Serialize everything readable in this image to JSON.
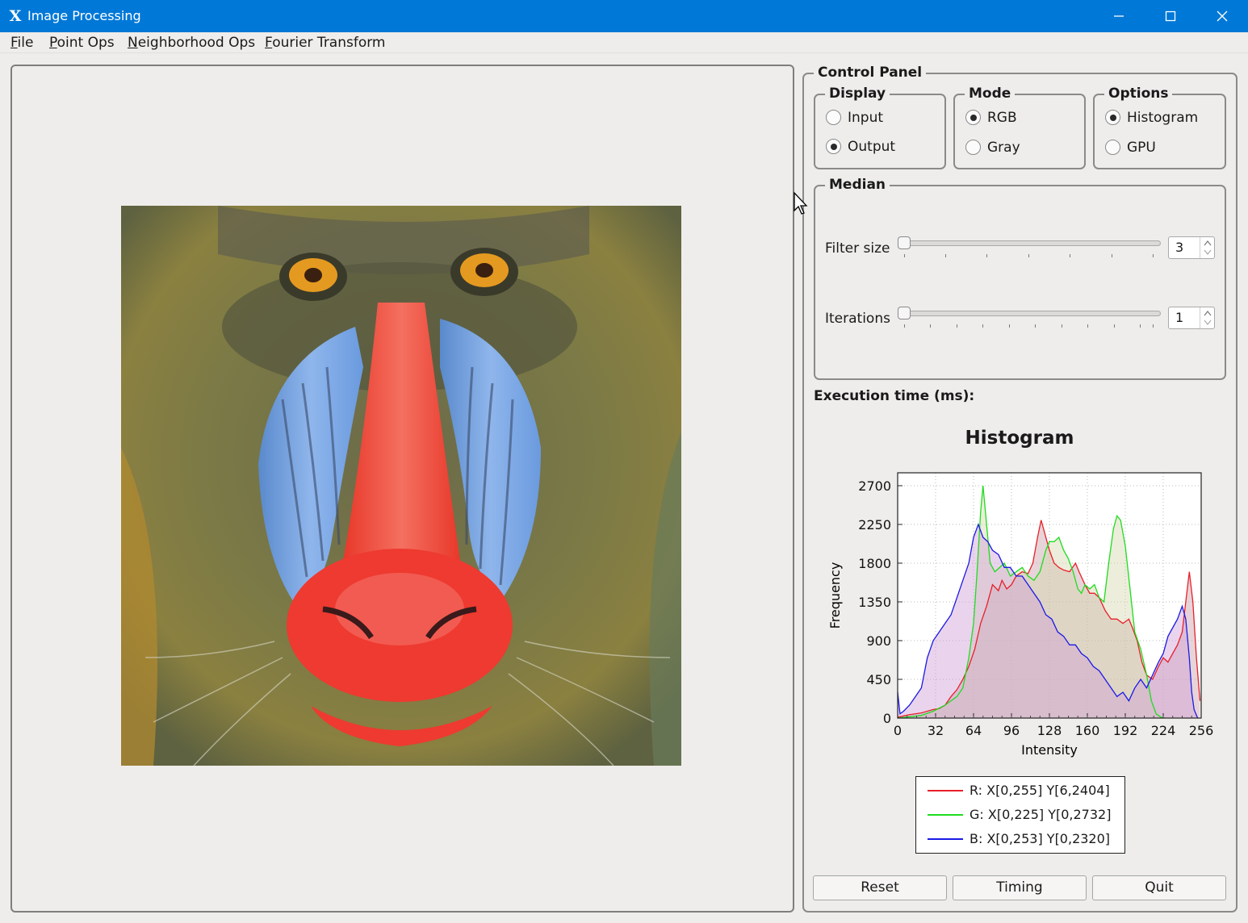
{
  "window": {
    "title": "Image Processing",
    "app_icon": "x-app-icon",
    "controls": [
      "minimize-icon",
      "maximize-icon",
      "close-icon"
    ]
  },
  "menubar": {
    "items": [
      {
        "label_mn": "F",
        "label_rest": "ile"
      },
      {
        "label_mn": "P",
        "label_rest": "oint Ops"
      },
      {
        "label_mn": "N",
        "label_rest": "eighborhood Ops"
      },
      {
        "label_mn": "F",
        "label_rest": "ourier Transform"
      }
    ]
  },
  "control_panel": {
    "title": "Control Panel",
    "display": {
      "title": "Display",
      "options": [
        "Input",
        "Output"
      ],
      "selected": "Output"
    },
    "mode": {
      "title": "Mode",
      "options": [
        "RGB",
        "Gray"
      ],
      "selected": "RGB"
    },
    "options": {
      "title": "Options",
      "options": [
        "Histogram",
        "GPU"
      ],
      "selected": "Histogram"
    },
    "median": {
      "title": "Median",
      "filter_size_label": "Filter size",
      "filter_size_value": "3",
      "iterations_label": "Iterations",
      "iterations_value": "1"
    },
    "execution_time_label": "Execution time (ms):"
  },
  "buttons": {
    "reset": "Reset",
    "timing": "Timing",
    "quit": "Quit"
  },
  "chart_data": {
    "type": "line",
    "title": "Histogram",
    "xlabel": "Intensity",
    "ylabel": "Frequency",
    "xlim": [
      0,
      256
    ],
    "ylim": [
      0,
      2850
    ],
    "xticks": [
      0,
      32,
      64,
      96,
      128,
      160,
      192,
      224,
      256
    ],
    "yticks": [
      0,
      450,
      900,
      1350,
      1800,
      2250,
      2700
    ],
    "grid": true,
    "legend_position": "below",
    "series": [
      {
        "name": "R: X[0,255] Y[6,2404]",
        "color": "#e8202a",
        "fill": "#c8a0a8",
        "points": [
          [
            0,
            10
          ],
          [
            10,
            40
          ],
          [
            20,
            60
          ],
          [
            30,
            100
          ],
          [
            35,
            110
          ],
          [
            40,
            150
          ],
          [
            45,
            250
          ],
          [
            50,
            330
          ],
          [
            55,
            450
          ],
          [
            60,
            600
          ],
          [
            65,
            800
          ],
          [
            70,
            1100
          ],
          [
            75,
            1300
          ],
          [
            80,
            1550
          ],
          [
            85,
            1480
          ],
          [
            88,
            1600
          ],
          [
            92,
            1500
          ],
          [
            96,
            1550
          ],
          [
            100,
            1650
          ],
          [
            105,
            1700
          ],
          [
            110,
            1680
          ],
          [
            114,
            1800
          ],
          [
            118,
            2100
          ],
          [
            121,
            2300
          ],
          [
            124,
            2150
          ],
          [
            128,
            1950
          ],
          [
            132,
            1800
          ],
          [
            136,
            1750
          ],
          [
            140,
            1720
          ],
          [
            145,
            1700
          ],
          [
            150,
            1800
          ],
          [
            153,
            1700
          ],
          [
            158,
            1550
          ],
          [
            162,
            1450
          ],
          [
            166,
            1450
          ],
          [
            170,
            1400
          ],
          [
            175,
            1250
          ],
          [
            180,
            1150
          ],
          [
            185,
            1150
          ],
          [
            190,
            1100
          ],
          [
            195,
            1150
          ],
          [
            198,
            1050
          ],
          [
            202,
            900
          ],
          [
            206,
            650
          ],
          [
            210,
            500
          ],
          [
            215,
            450
          ],
          [
            220,
            600
          ],
          [
            224,
            700
          ],
          [
            228,
            650
          ],
          [
            232,
            750
          ],
          [
            236,
            850
          ],
          [
            240,
            1000
          ],
          [
            243,
            1350
          ],
          [
            246,
            1700
          ],
          [
            249,
            1350
          ],
          [
            252,
            700
          ],
          [
            255,
            200
          ]
        ]
      },
      {
        "name": "G: X[0,225] Y[0,2732]",
        "color": "#1edc1e",
        "fill": "#d8d8b0",
        "points": [
          [
            0,
            0
          ],
          [
            20,
            30
          ],
          [
            30,
            80
          ],
          [
            40,
            150
          ],
          [
            50,
            250
          ],
          [
            55,
            350
          ],
          [
            60,
            700
          ],
          [
            64,
            1100
          ],
          [
            67,
            1700
          ],
          [
            70,
            2400
          ],
          [
            72,
            2700
          ],
          [
            74,
            2400
          ],
          [
            78,
            1800
          ],
          [
            82,
            1700
          ],
          [
            86,
            1750
          ],
          [
            90,
            1800
          ],
          [
            95,
            1650
          ],
          [
            100,
            1700
          ],
          [
            105,
            1750
          ],
          [
            110,
            1650
          ],
          [
            115,
            1600
          ],
          [
            120,
            1700
          ],
          [
            125,
            1950
          ],
          [
            128,
            2050
          ],
          [
            132,
            2050
          ],
          [
            136,
            2100
          ],
          [
            140,
            1950
          ],
          [
            144,
            1850
          ],
          [
            148,
            1700
          ],
          [
            152,
            1500
          ],
          [
            155,
            1450
          ],
          [
            158,
            1550
          ],
          [
            162,
            1500
          ],
          [
            166,
            1550
          ],
          [
            170,
            1400
          ],
          [
            174,
            1350
          ],
          [
            178,
            1800
          ],
          [
            182,
            2200
          ],
          [
            185,
            2350
          ],
          [
            188,
            2300
          ],
          [
            192,
            2000
          ],
          [
            196,
            1500
          ],
          [
            200,
            1000
          ],
          [
            205,
            800
          ],
          [
            210,
            500
          ],
          [
            214,
            200
          ],
          [
            218,
            50
          ],
          [
            222,
            10
          ],
          [
            225,
            0
          ]
        ]
      },
      {
        "name": "B: X[0,253] Y[0,2320]",
        "color": "#1a1ae6",
        "fill": "#d0a0d8",
        "points": [
          [
            0,
            300
          ],
          [
            2,
            50
          ],
          [
            5,
            80
          ],
          [
            10,
            150
          ],
          [
            15,
            250
          ],
          [
            20,
            350
          ],
          [
            25,
            700
          ],
          [
            30,
            900
          ],
          [
            35,
            1000
          ],
          [
            40,
            1100
          ],
          [
            45,
            1200
          ],
          [
            50,
            1400
          ],
          [
            55,
            1600
          ],
          [
            60,
            1800
          ],
          [
            64,
            2100
          ],
          [
            68,
            2250
          ],
          [
            72,
            2100
          ],
          [
            76,
            2050
          ],
          [
            80,
            1950
          ],
          [
            85,
            1900
          ],
          [
            90,
            1750
          ],
          [
            95,
            1750
          ],
          [
            100,
            1650
          ],
          [
            105,
            1650
          ],
          [
            110,
            1550
          ],
          [
            115,
            1450
          ],
          [
            120,
            1350
          ],
          [
            125,
            1200
          ],
          [
            130,
            1150
          ],
          [
            135,
            1000
          ],
          [
            140,
            950
          ],
          [
            145,
            850
          ],
          [
            150,
            850
          ],
          [
            155,
            750
          ],
          [
            160,
            700
          ],
          [
            165,
            600
          ],
          [
            170,
            550
          ],
          [
            175,
            450
          ],
          [
            180,
            350
          ],
          [
            185,
            250
          ],
          [
            190,
            300
          ],
          [
            195,
            200
          ],
          [
            200,
            350
          ],
          [
            205,
            450
          ],
          [
            210,
            350
          ],
          [
            215,
            500
          ],
          [
            220,
            650
          ],
          [
            224,
            750
          ],
          [
            228,
            950
          ],
          [
            232,
            1050
          ],
          [
            236,
            1150
          ],
          [
            240,
            1300
          ],
          [
            243,
            1150
          ],
          [
            246,
            700
          ],
          [
            248,
            300
          ],
          [
            250,
            100
          ],
          [
            253,
            0
          ]
        ]
      }
    ]
  }
}
